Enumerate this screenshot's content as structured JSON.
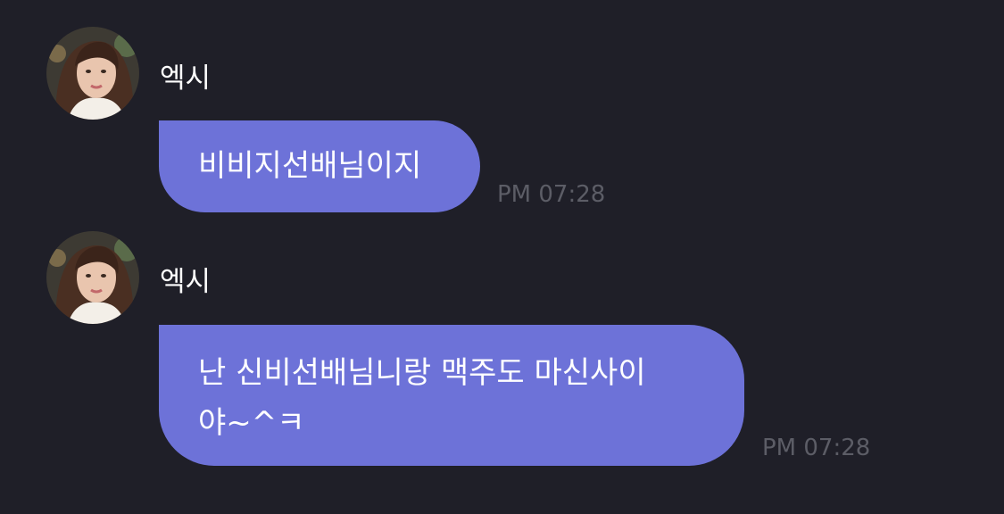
{
  "messages": [
    {
      "sender": "엑시",
      "avatar_icon": "profile-photo-icon",
      "text": "비비지선배님이지",
      "time": "PM 07:28"
    },
    {
      "sender": "엑시",
      "avatar_icon": "profile-photo-icon",
      "text": "난 신비선배님니랑 맥주도 마신사이\n야~^ㅋ",
      "time": "PM 07:28"
    }
  ],
  "colors": {
    "background": "#1f1f28",
    "bubble": "#6d72d8",
    "timestamp": "#5c5d66",
    "text": "#ffffff"
  }
}
